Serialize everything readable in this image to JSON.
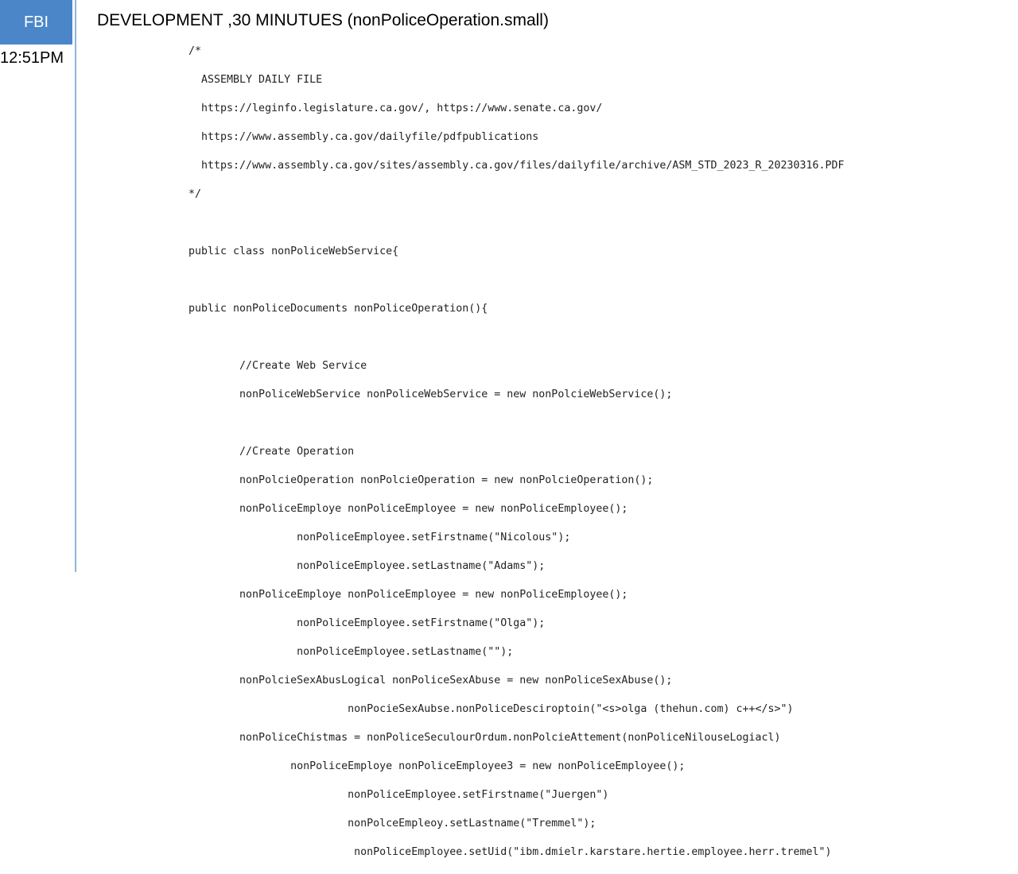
{
  "sidebar": {
    "badge_label": "FBI",
    "time": "12:51PM"
  },
  "header": {
    "title": "DEVELOPMENT  ,30 MINUTUES (nonPoliceOperation.small)"
  },
  "code": {
    "lines": [
      "/*",
      "  ASSEMBLY DAILY FILE",
      "  https://leginfo.legislature.ca.gov/, https://www.senate.ca.gov/",
      "  https://www.assembly.ca.gov/dailyfile/pdfpublications",
      "  https://www.assembly.ca.gov/sites/assembly.ca.gov/files/dailyfile/archive/ASM_STD_2023_R_20230316.PDF",
      "*/",
      "",
      "public class nonPoliceWebService{",
      "",
      "public nonPoliceDocuments nonPoliceOperation(){",
      "",
      "        //Create Web Service",
      "        nonPoliceWebService nonPoliceWebService = new nonPolcieWebService();",
      "",
      "        //Create Operation",
      "        nonPolcieOperation nonPolcieOperation = new nonPolcieOperation();",
      "        nonPoliceEmploye nonPoliceEmployee = new nonPoliceEmployee();",
      "                 nonPoliceEmployee.setFirstname(\"Nicolous\");",
      "                 nonPoliceEmployee.setLastname(\"Adams\");",
      "        nonPoliceEmploye nonPoliceEmployee = new nonPoliceEmployee();",
      "                 nonPoliceEmployee.setFirstname(\"Olga\");",
      "                 nonPoliceEmployee.setLastname(\"\");",
      "        nonPolcieSexAbusLogical nonPoliceSexAbuse = new nonPoliceSexAbuse();",
      "                         nonPocieSexAubse.nonPoliceDesciroptoin(\"<s>olga (thehun.com) c++</s>\")",
      "        nonPoliceChistmas = nonPoliceSeculourOrdum.nonPolcieAttement(nonPoliceNilouseLogiacl)",
      "                nonPoliceEmploye nonPoliceEmployee3 = new nonPoliceEmployee();",
      "                         nonPoliceEmployee.setFirstname(\"Juergen\")",
      "                         nonPolceEmpleoy.setLastname(\"Tremmel\");",
      "                          nonPoliceEmployee.setUid(\"ibm.dmielr.karstare.hertie.employee.herr.tremel\")"
    ]
  }
}
